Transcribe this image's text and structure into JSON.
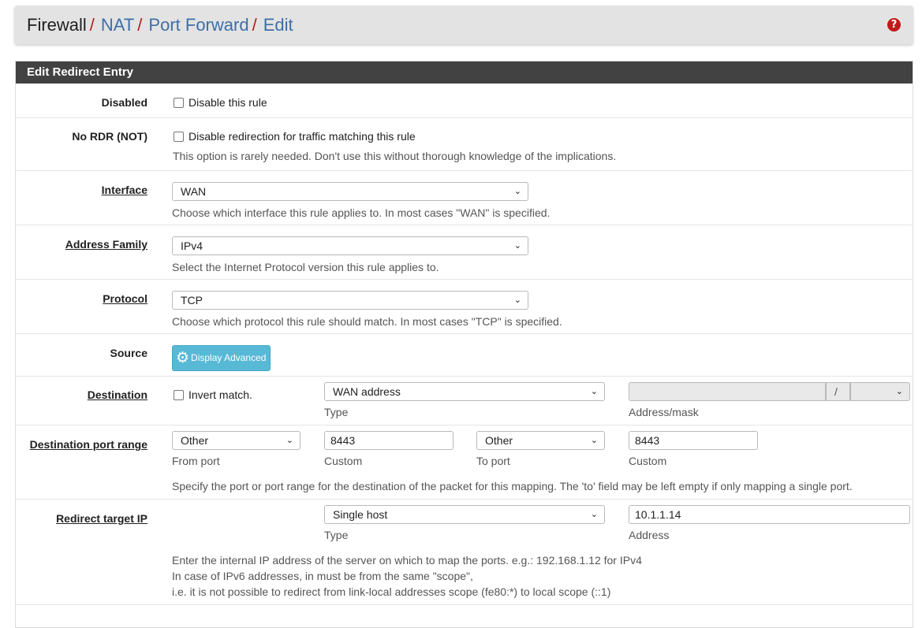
{
  "breadcrumb": {
    "root": "Firewall",
    "sep": "/",
    "items": [
      "NAT",
      "Port Forward",
      "Edit"
    ],
    "help_icon": "question-circle-icon"
  },
  "panel": {
    "title": "Edit Redirect Entry"
  },
  "disabled": {
    "label": "Disabled",
    "checkbox_label": "Disable this rule"
  },
  "nordr": {
    "label": "No RDR (NOT)",
    "checkbox_label": "Disable redirection for traffic matching this rule",
    "help": "This option is rarely needed. Don't use this without thorough knowledge of the implications."
  },
  "interface": {
    "label": "Interface",
    "value": "WAN",
    "help": "Choose which interface this rule applies to. In most cases \"WAN\" is specified."
  },
  "address_family": {
    "label": "Address Family",
    "value": "IPv4",
    "help": "Select the Internet Protocol version this rule applies to."
  },
  "protocol": {
    "label": "Protocol",
    "value": "TCP",
    "help": "Choose which protocol this rule should match. In most cases \"TCP\" is specified."
  },
  "source": {
    "label": "Source",
    "button": "Display Advanced",
    "button_icon": "gear-icon"
  },
  "destination": {
    "label": "Destination",
    "invert_label": "Invert match.",
    "type_value": "WAN address",
    "type_caption": "Type",
    "address_value": "",
    "mask_sep": "/",
    "mask_value": "",
    "address_caption": "Address/mask"
  },
  "dest_port": {
    "label": "Destination port range",
    "from_value": "Other",
    "from_caption": "From port",
    "from_custom": "8443",
    "from_custom_caption": "Custom",
    "to_value": "Other",
    "to_caption": "To port",
    "to_custom": "8443",
    "to_custom_caption": "Custom",
    "help": "Specify the port or port range for the destination of the packet for this mapping. The 'to' field may be left empty if only mapping a single port."
  },
  "redirect": {
    "label": "Redirect target IP",
    "type_value": "Single host",
    "type_caption": "Type",
    "address_value": "10.1.1.14",
    "address_caption": "Address",
    "help1": "Enter the internal IP address of the server on which to map the ports. e.g.: 192.168.1.12 for IPv4",
    "help2": "In case of IPv6 addresses, in must be from the same \"scope\",",
    "help3": "i.e. it is not possible to redirect from link-local addresses scope (fe80:*) to local scope (::1)"
  }
}
